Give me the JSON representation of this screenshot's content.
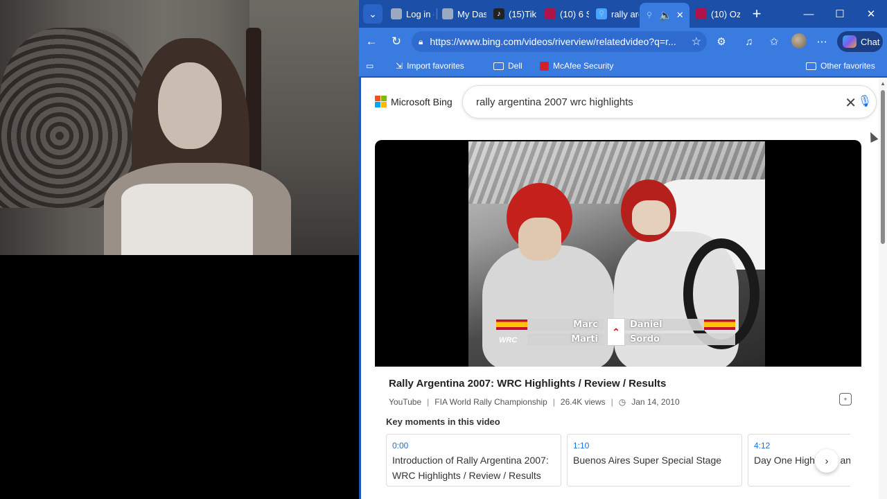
{
  "browser": {
    "tabs": [
      {
        "label": "Log in -",
        "color": "#9aa8c0"
      },
      {
        "label": "My Das",
        "color": "#9aa8c0"
      },
      {
        "label": "(15)Tik",
        "color": "#222222"
      },
      {
        "label": "(10) 6 S",
        "color": "#b0124a"
      },
      {
        "label": "rally arg",
        "color": "#4aa3ff"
      },
      {
        "label": "",
        "color": "#4aa3ff"
      },
      {
        "label": "(10) Oz",
        "color": "#b0124a"
      }
    ],
    "url": "https://www.bing.com/videos/riverview/relatedvideo?q=r...",
    "chat_label": "Chat",
    "favorites": {
      "import": "Import favorites",
      "dell": "Dell",
      "mcafee": "McAfee Security",
      "other": "Other favorites"
    }
  },
  "bing": {
    "logo_text": "Microsoft Bing",
    "query": "rally argentina 2007 wrc highlights"
  },
  "video": {
    "caption_left_top": "Marc",
    "caption_left_bottom": "Marti",
    "caption_right_top": "Daniel",
    "caption_right_bottom": "Sordo",
    "wrc_logo": "WRC",
    "title": "Rally Argentina 2007: WRC Highlights / Review / Results",
    "source": "YouTube",
    "channel": "FIA World Rally Championship",
    "views": "26.4K views",
    "date": "Jan 14, 2010"
  },
  "key_moments": {
    "title": "Key moments in this video",
    "items": [
      {
        "time": "0:00",
        "text": "Introduction of Rally Argentina 2007: WRC Highlights / Review / Results"
      },
      {
        "time": "1:10",
        "text": "Buenos Aires Super Special Stage"
      },
      {
        "time": "4:12",
        "text": "Day One Highlights and"
      }
    ]
  }
}
